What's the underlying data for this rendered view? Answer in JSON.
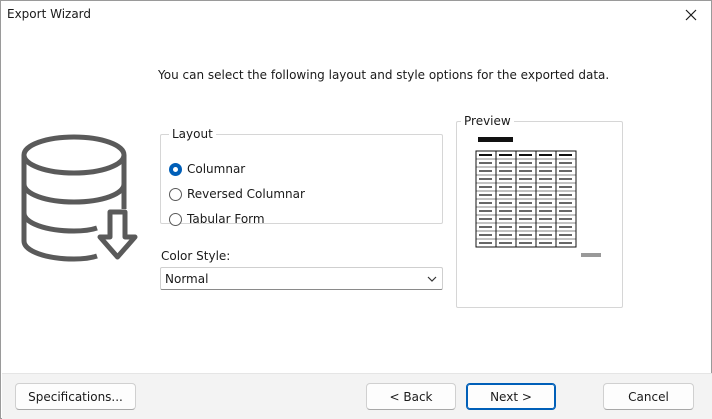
{
  "window": {
    "title": "Export Wizard",
    "close_icon": "close-icon"
  },
  "intro_text": "You can select the following layout and style options for the exported data.",
  "icon": {
    "name": "database-export-icon",
    "color": "#5a5a5a"
  },
  "layout": {
    "legend": "Layout",
    "options": [
      {
        "label": "Columnar",
        "checked": true
      },
      {
        "label": "Reversed Columnar",
        "checked": false
      },
      {
        "label": "Tabular Form",
        "checked": false
      }
    ]
  },
  "color_style": {
    "label": "Color Style:",
    "value": "Normal"
  },
  "preview": {
    "legend": "Preview",
    "columns": 5,
    "rows": 12
  },
  "buttons": {
    "specifications": "Specifications...",
    "back": "< Back",
    "next": "Next >",
    "cancel": "Cancel"
  },
  "colors": {
    "accent": "#005fb8",
    "footer_bg": "#f3f3f3"
  }
}
